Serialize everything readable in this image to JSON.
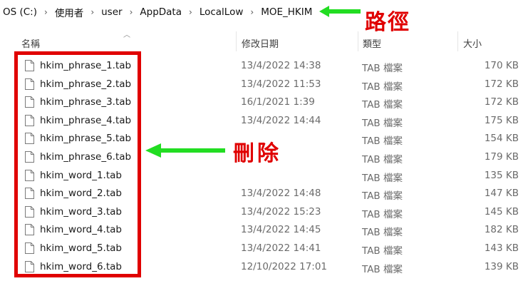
{
  "breadcrumb": [
    "OS (C:)",
    "使用者",
    "user",
    "AppData",
    "LocalLow",
    "MOE_HKIM"
  ],
  "annotations": {
    "path_label": "路徑",
    "delete_label": "刪除",
    "annotation_color": "#e00000",
    "arrow_color": "#22dd22"
  },
  "columns": {
    "name": "名稱",
    "modified": "修改日期",
    "type": "類型",
    "size": "大小"
  },
  "files": [
    {
      "name": "hkim_phrase_1.tab",
      "modified": "13/4/2022 14:38",
      "type": "TAB 檔案",
      "size": "170 KB"
    },
    {
      "name": "hkim_phrase_2.tab",
      "modified": "13/4/2022 11:53",
      "type": "TAB 檔案",
      "size": "172 KB"
    },
    {
      "name": "hkim_phrase_3.tab",
      "modified": "16/1/2021 1:39",
      "type": "TAB 檔案",
      "size": "172 KB"
    },
    {
      "name": "hkim_phrase_4.tab",
      "modified": "13/4/2022 14:44",
      "type": "TAB 檔案",
      "size": "175 KB"
    },
    {
      "name": "hkim_phrase_5.tab",
      "modified": "",
      "type": "TAB 檔案",
      "size": "154 KB"
    },
    {
      "name": "hkim_phrase_6.tab",
      "modified": "",
      "type": "TAB 檔案",
      "size": "179 KB"
    },
    {
      "name": "hkim_word_1.tab",
      "modified": "",
      "type": "TAB 檔案",
      "size": "135 KB"
    },
    {
      "name": "hkim_word_2.tab",
      "modified": "13/4/2022 14:48",
      "type": "TAB 檔案",
      "size": "147 KB"
    },
    {
      "name": "hkim_word_3.tab",
      "modified": "13/4/2022 15:23",
      "type": "TAB 檔案",
      "size": "145 KB"
    },
    {
      "name": "hkim_word_4.tab",
      "modified": "13/4/2022 14:45",
      "type": "TAB 檔案",
      "size": "182 KB"
    },
    {
      "name": "hkim_word_5.tab",
      "modified": "13/4/2022 14:41",
      "type": "TAB 檔案",
      "size": "143 KB"
    },
    {
      "name": "hkim_word_6.tab",
      "modified": "12/10/2022 17:01",
      "type": "TAB 檔案",
      "size": "139 KB"
    }
  ]
}
